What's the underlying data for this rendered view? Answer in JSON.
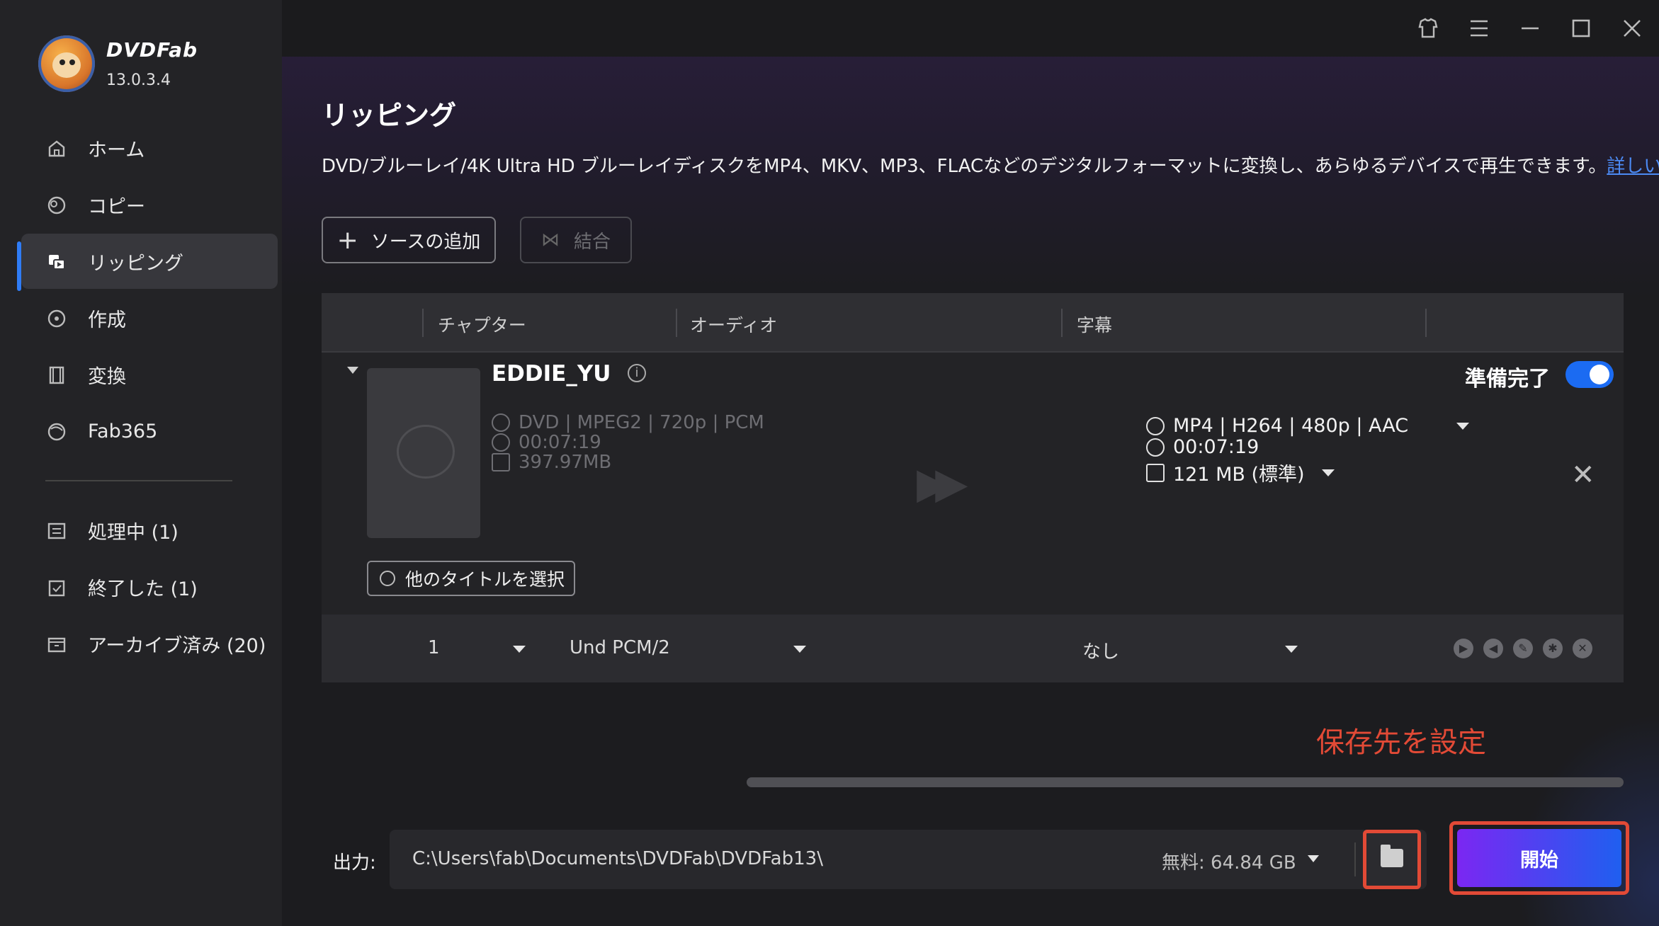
{
  "app": {
    "brand": "DVDFab",
    "version": "13.0.3.4"
  },
  "sidebar": {
    "items": [
      {
        "label": "ホーム",
        "icon": "home-icon"
      },
      {
        "label": "コピー",
        "icon": "copy-icon"
      },
      {
        "label": "リッピング",
        "icon": "ripper-icon",
        "active": true
      },
      {
        "label": "作成",
        "icon": "creator-icon"
      },
      {
        "label": "変換",
        "icon": "converter-icon"
      },
      {
        "label": "Fab365",
        "icon": "fab365-icon"
      }
    ],
    "queue": [
      {
        "label": "処理中 (1)",
        "icon": "processing-icon"
      },
      {
        "label": "終了した (1)",
        "icon": "finished-icon"
      },
      {
        "label": "アーカイブ済み (20)",
        "icon": "archive-icon"
      }
    ]
  },
  "titlebar": {
    "icons": [
      "shirt-icon",
      "menu-icon",
      "minimize-icon",
      "maximize-icon",
      "close-icon"
    ]
  },
  "main": {
    "title": "リッピング",
    "description": "DVD/ブルーレイ/4K Ultra HD ブルーレイディスクをMP4、MKV、MP3、FLACなどのデジタルフォーマットに変換し、あらゆるデバイスで再生できます。",
    "more_link": "詳しい情報...",
    "add_source": "ソースの追加",
    "merge": "結合"
  },
  "table": {
    "headers": [
      "チャプター",
      "オーディオ",
      "字幕"
    ],
    "item": {
      "name": "EDDIE_YU",
      "source": {
        "format": "DVD | MPEG2 | 720p | PCM",
        "duration": "00:07:19",
        "size": "397.97MB"
      },
      "output": {
        "format": "MP4 | H264 | 480p | AAC",
        "duration": "00:07:19",
        "size": "121 MB (標準)"
      },
      "ready_label": "準備完了",
      "ready": true,
      "other_titles": "他のタイトルを選択"
    },
    "row": {
      "chapter": "1",
      "audio": "Und  PCM/2",
      "subtitle": "なし"
    }
  },
  "annotation": "保存先を設定",
  "output": {
    "label": "出力:",
    "path": "C:\\Users\\fab\\Documents\\DVDFab\\DVDFab13\\",
    "free": "無料: 64.84 GB",
    "start": "開始"
  },
  "colors": {
    "accent": "#1b6bf2",
    "highlight": "#e24a36",
    "start_from": "#7b27f2",
    "start_to": "#1f5ff0"
  }
}
